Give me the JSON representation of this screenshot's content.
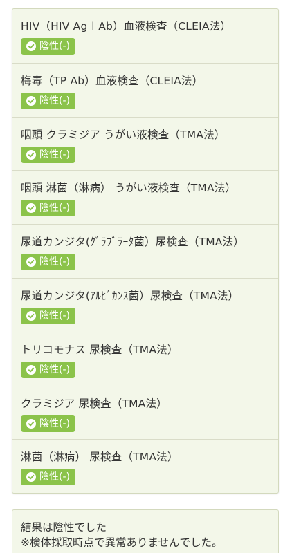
{
  "tests": [
    {
      "name": "HIV（HIV Ag＋Ab）血液検査（CLEIA法）",
      "result": "陰性(-)"
    },
    {
      "name": "梅毒（TP Ab）血液検査（CLEIA法）",
      "result": "陰性(-)"
    },
    {
      "name": "咽頭 クラミジア うがい液検査（TMA法）",
      "result": "陰性(-)"
    },
    {
      "name": "咽頭 淋菌（淋病） うがい液検査（TMA法）",
      "result": "陰性(-)"
    },
    {
      "name": "尿道カンジタ(ｸﾞﾗﾌﾞﾗｰﾀ菌）尿検査（TMA法）",
      "result": "陰性(-)"
    },
    {
      "name": "尿道カンジタ(ｱﾙﾋﾞｶﾝｽ菌）尿検査（TMA法）",
      "result": "陰性(-)"
    },
    {
      "name": "トリコモナス 尿検査（TMA法）",
      "result": "陰性(-)"
    },
    {
      "name": "クラミジア 尿検査（TMA法）",
      "result": "陰性(-)"
    },
    {
      "name": "淋菌（淋病） 尿検査（TMA法）",
      "result": "陰性(-)"
    }
  ],
  "summary": {
    "line1": "結果は陰性でした",
    "line2": "※検体採取時点で異常ありませんでした。"
  },
  "colors": {
    "badge": "#8bc34a",
    "card_bg": "#f3f7e9",
    "border": "#d3d9bd"
  },
  "icons": {
    "badge_icon": "check-circle-icon"
  }
}
